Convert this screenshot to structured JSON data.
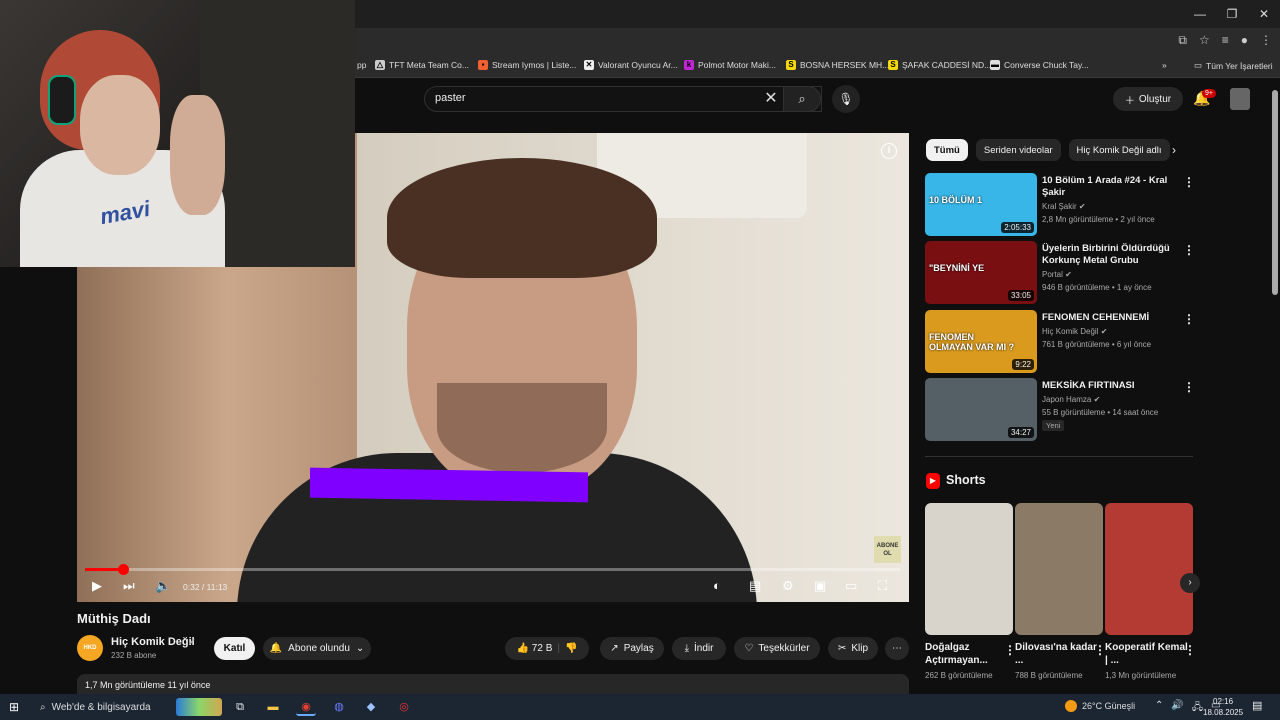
{
  "browser": {
    "bookmarks": [
      {
        "label": "pp",
        "icon": ""
      },
      {
        "label": "TFT Meta Team Co...",
        "icon": "△"
      },
      {
        "label": "Stream Iymos | Liste...",
        "icon": "▪"
      },
      {
        "label": "Valorant Oyuncu Ar...",
        "icon": "✕"
      },
      {
        "label": "Polmot Motor Maki...",
        "icon": "k"
      },
      {
        "label": "BOSNA HERSEK MH...",
        "icon": "S"
      },
      {
        "label": "ŞAFAK CADDESİ ND...",
        "icon": "S"
      },
      {
        "label": "Converse Chuck Tay...",
        "icon": "▬"
      }
    ],
    "bookmarks_more": "»",
    "all_bookmarks": "Tüm Yer İşaretleri"
  },
  "header": {
    "search_value": "paster",
    "create_label": "Oluştur",
    "notif_count": "9+"
  },
  "player": {
    "time_current": "0:32",
    "time_total": "11:13",
    "progress": 0.047,
    "subscribe_logo": "ABONE OL"
  },
  "video": {
    "title": "Müthiş Dadı",
    "channel": "Hiç Komik Değil",
    "channel_avatar_text": "HKD",
    "subscribers": "232 B abone",
    "join_label": "Katıl",
    "subscribed_label": "Abone olundu",
    "likes": "72 B",
    "share_label": "Paylaş",
    "download_label": "İndir",
    "thanks_label": "Teşekkürler",
    "clip_label": "Klip",
    "views_date": "1,7 Mn görüntüleme  11 yıl önce"
  },
  "sidebar": {
    "chips": [
      "Tümü",
      "Seriden videolar",
      "Hiç Komik Değil adlı"
    ],
    "recommendations": [
      {
        "title": "10 Bölüm 1 Arada #24 - Kral Şakir",
        "channel": "Kral Şakir",
        "meta": "2,8 Mn görüntüleme • 2 yıl önce",
        "duration": "2:05:33",
        "thumb_label": "10 BÖLÜM 1",
        "color": "#38b6e8",
        "badge": ""
      },
      {
        "title": "Üyelerin Birbirini Öldürdüğü Korkunç Metal Grubu",
        "channel": "Portal",
        "meta": "946 B görüntüleme • 1 ay önce",
        "duration": "33:05",
        "thumb_label": "\"BEYNİNİ YE",
        "color": "#7a0f12",
        "badge": ""
      },
      {
        "title": "FENOMEN CEHENNEMİ",
        "channel": "Hiç Komik Değil",
        "meta": "761 B görüntüleme • 6 yıl önce",
        "duration": "9:22",
        "thumb_label": "FENOMEN OLMAYAN VAR MI ?",
        "color": "#d99a1e",
        "badge": ""
      },
      {
        "title": "MEKSİKA FIRTINASI",
        "channel": "Japon Hamza",
        "meta": "55 B görüntüleme • 14 saat önce",
        "duration": "34:27",
        "thumb_label": "",
        "color": "#556066",
        "badge": "Yeni"
      }
    ],
    "shorts_title": "Shorts",
    "shorts": [
      {
        "title": "Doğalgaz Açtırmayan...",
        "views": "262 B görüntüleme",
        "color": "#d8d4cc"
      },
      {
        "title": "Dilovası'na kadar ...",
        "views": "788 B görüntüleme",
        "color": "#8a7a66"
      },
      {
        "title": "Kooperatif Kemal | ...",
        "views": "1,3 Mn görüntüleme",
        "color": "#b43a34"
      }
    ]
  },
  "taskbar": {
    "search_placeholder": "Web'de & bilgisayarda",
    "weather": "26°C  Güneşli",
    "time": "02:16",
    "date": "18.08.2025"
  },
  "colors": {
    "accent": "#ff0000",
    "purple_bar": "#8000ff"
  }
}
